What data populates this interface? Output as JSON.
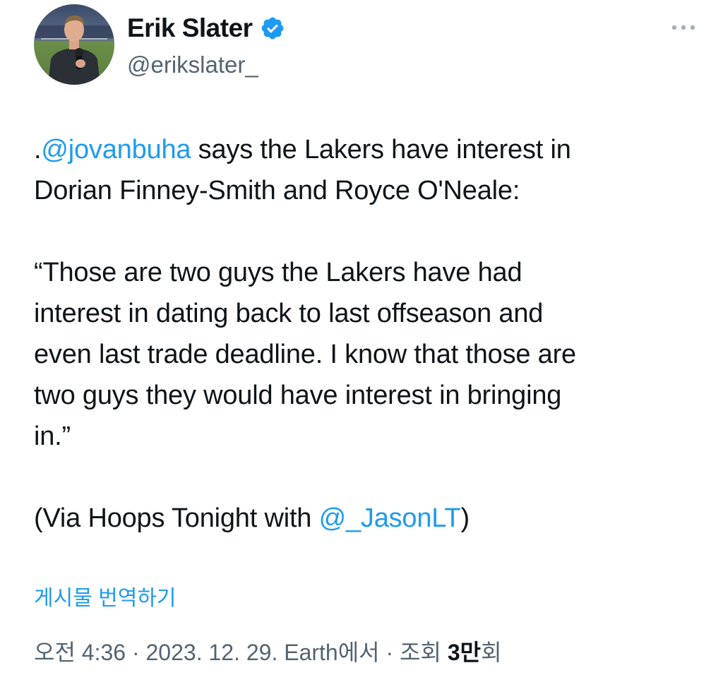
{
  "author": {
    "display_name": "Erik Slater",
    "handle": "@erikslater_",
    "verified": true,
    "avatar_icon": "profile-photo"
  },
  "tweet": {
    "line1_prefix": ".",
    "line1_mention": "@jovanbuha",
    "line1_text": " says the Lakers have interest in",
    "line2_text": "Dorian Finney-Smith and Royce O'Neale:",
    "quote_lines": [
      "“Those are two guys the Lakers have had",
      "interest in dating back to last offseason and",
      "even last trade deadline. I know that those are",
      "two guys they would have interest in bringing",
      "in.”"
    ],
    "via_prefix": "(Via Hoops Tonight with ",
    "via_mention": "@_JasonLT",
    "via_suffix": ")"
  },
  "translate_label": "게시물 번역하기",
  "meta": {
    "time": "오전 4:36",
    "separator": " · ",
    "date": "2023. 12. 29.",
    "source": "Earth에서",
    "views_label_prefix": "조회 ",
    "views_count": "3만",
    "views_label_suffix": "회"
  },
  "colors": {
    "link": "#1d9bf0",
    "text": "#0f1419",
    "secondary": "#536471",
    "verified_badge": "#1d9bf0"
  }
}
